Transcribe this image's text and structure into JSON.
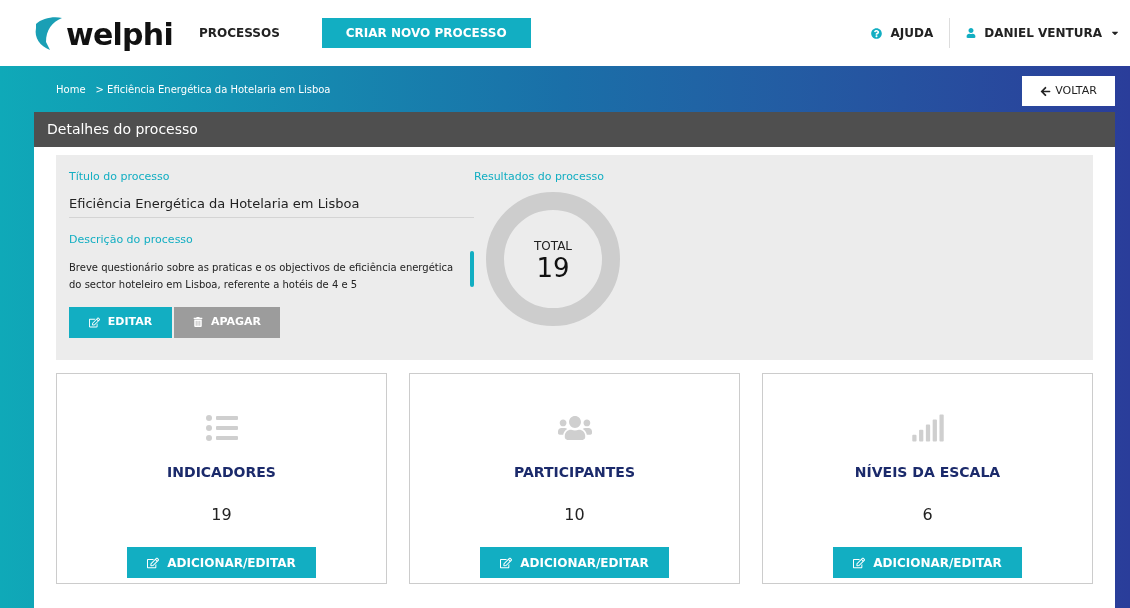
{
  "header": {
    "logo": "welphi",
    "nav": "PROCESSOS",
    "create_button": "CRIAR NOVO PROCESSO",
    "help": "AJUDA",
    "user": "DANIEL VENTURA"
  },
  "breadcrumb": {
    "home": "Home",
    "current": "> Eficiência Energética da Hotelaria em Lisboa"
  },
  "back_button": "VOLTAR",
  "panel": {
    "title": "Detalhes do processo",
    "title_label": "Título do processo",
    "title_value": "Eficiência Energética da Hotelaria em Lisboa",
    "description_label": "Descrição do processo",
    "description_value": "Breve questionário sobre as praticas e os objectivos de eficiência energética do sector hoteleiro em Lisboa, referente a hotéis de 4 e 5",
    "edit_button": "EDITAR",
    "delete_button": "APAGAR",
    "results_label": "Resultados do processo",
    "total_label": "TOTAL",
    "total_value": "19"
  },
  "cards": [
    {
      "kind": "list",
      "title": "INDICADORES",
      "count": "19",
      "button": "ADICIONAR/EDITAR"
    },
    {
      "kind": "users",
      "title": "PARTICIPANTES",
      "count": "10",
      "button": "ADICIONAR/EDITAR"
    },
    {
      "kind": "signal",
      "title": "NÍVEIS DA ESCALA",
      "count": "6",
      "button": "ADICIONAR/EDITAR"
    }
  ]
}
